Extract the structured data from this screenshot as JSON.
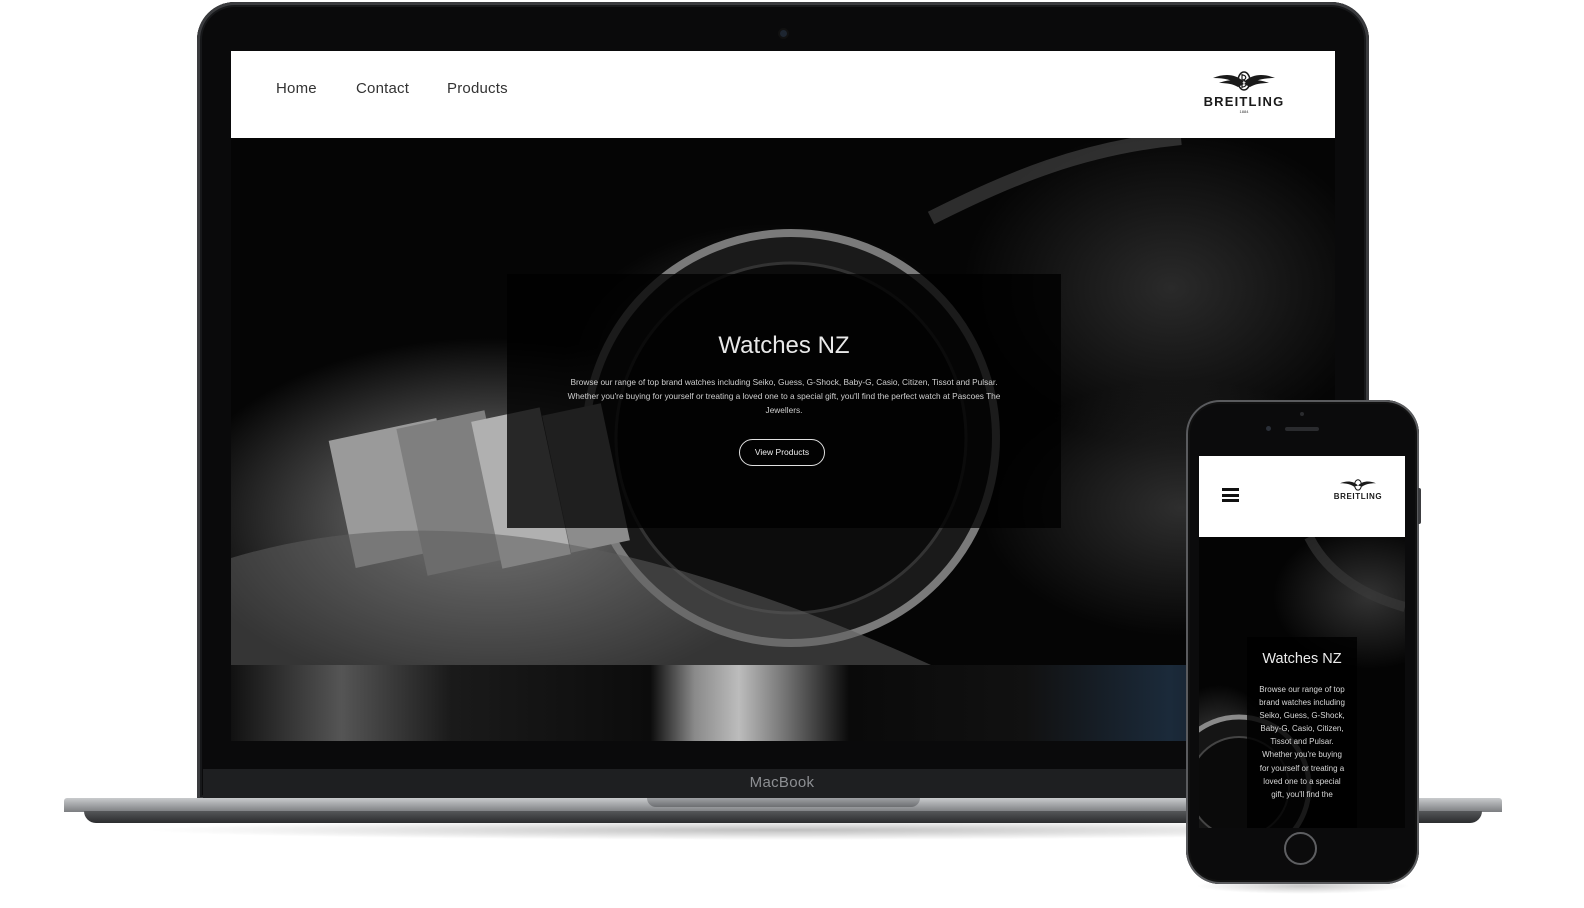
{
  "desktop_site": {
    "nav": [
      "Home",
      "Contact",
      "Products"
    ],
    "logo": {
      "name": "BREITLING",
      "year": "1884"
    },
    "hero": {
      "title": "Watches NZ",
      "description": "Browse our range of top brand watches including Seiko, Guess, G-Shock, Baby-G, Casio, Citizen, Tissot and Pulsar. Whether you're buying for yourself or treating a loved one to a special gift, you'll find the perfect watch at Pascoes The Jewellers.",
      "button": "View Products"
    }
  },
  "laptop": {
    "label": "MacBook"
  },
  "mobile_site": {
    "menu_icon": "hamburger-menu-icon",
    "logo": {
      "name": "BREITLING"
    },
    "hero": {
      "title": "Watches NZ",
      "description": "Browse our range of top brand watches including Seiko, Guess, G-Shock, Baby-G, Casio, Citizen, Tissot and Pulsar. Whether you're buying for yourself or treating a loved one to a special gift, you'll find the"
    }
  },
  "colors": {
    "background": "#ffffff",
    "header": "#ffffff",
    "hero": "#000000",
    "text_light": "#e8e8e8"
  }
}
